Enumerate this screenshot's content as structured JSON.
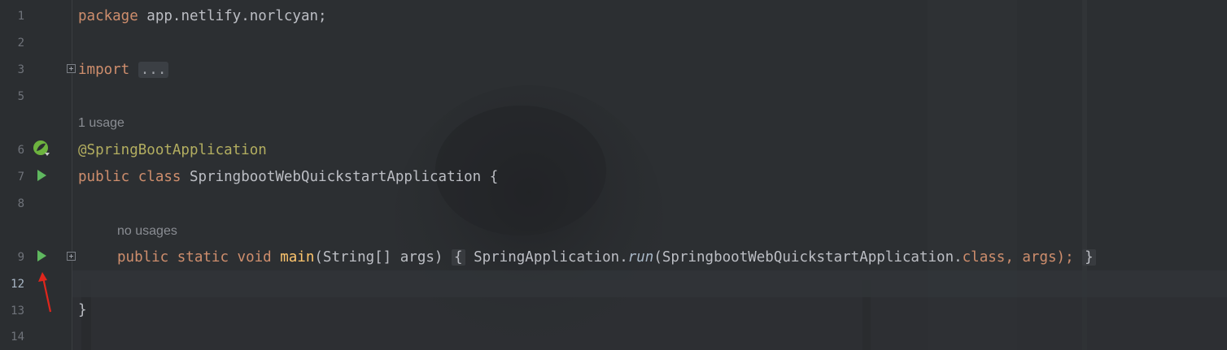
{
  "editor": {
    "line_numbers": [
      "1",
      "2",
      "3",
      "5",
      "6",
      "7",
      "8",
      "9",
      "12",
      "13",
      "14"
    ],
    "current_line_number": "12",
    "lines": {
      "l1": {
        "kw": "package",
        "rest": " app.netlify.norlcyan;"
      },
      "l3": {
        "kw": "import",
        "fold": "..."
      },
      "hint_usage_class": "1 usage",
      "l6": {
        "annotation": "@SpringBootApplication"
      },
      "l7": {
        "kw1": "public",
        "kw2": "class",
        "name": "SpringbootWebQuickstartApplication",
        "brace": "{"
      },
      "hint_usage_main": "no usages",
      "l9": {
        "kw1": "public",
        "kw2": "static",
        "kw3": "void",
        "method": "main",
        "params_open": "(String[] args)",
        "brace_open": "{",
        "call_class": "SpringApplication.",
        "call_method": "run",
        "args_start": "(SpringbootWebQuickstartApplication.",
        "class_kw": "class",
        "args_end": ", args);",
        "brace_close": "}"
      },
      "l13": {
        "brace": "}"
      }
    },
    "colors": {
      "background": "#2a2d30",
      "keyword": "#cf8e6d",
      "annotation": "#b3ae60",
      "method_decl": "#ffc66d",
      "text": "#bcbec4",
      "run_icon": "#5fb85f",
      "arrow": "#e0261c"
    },
    "icons": {
      "spring": "spring-boot-icon",
      "run": "run-gutter-icon",
      "fold": "fold-expand-icon"
    }
  }
}
